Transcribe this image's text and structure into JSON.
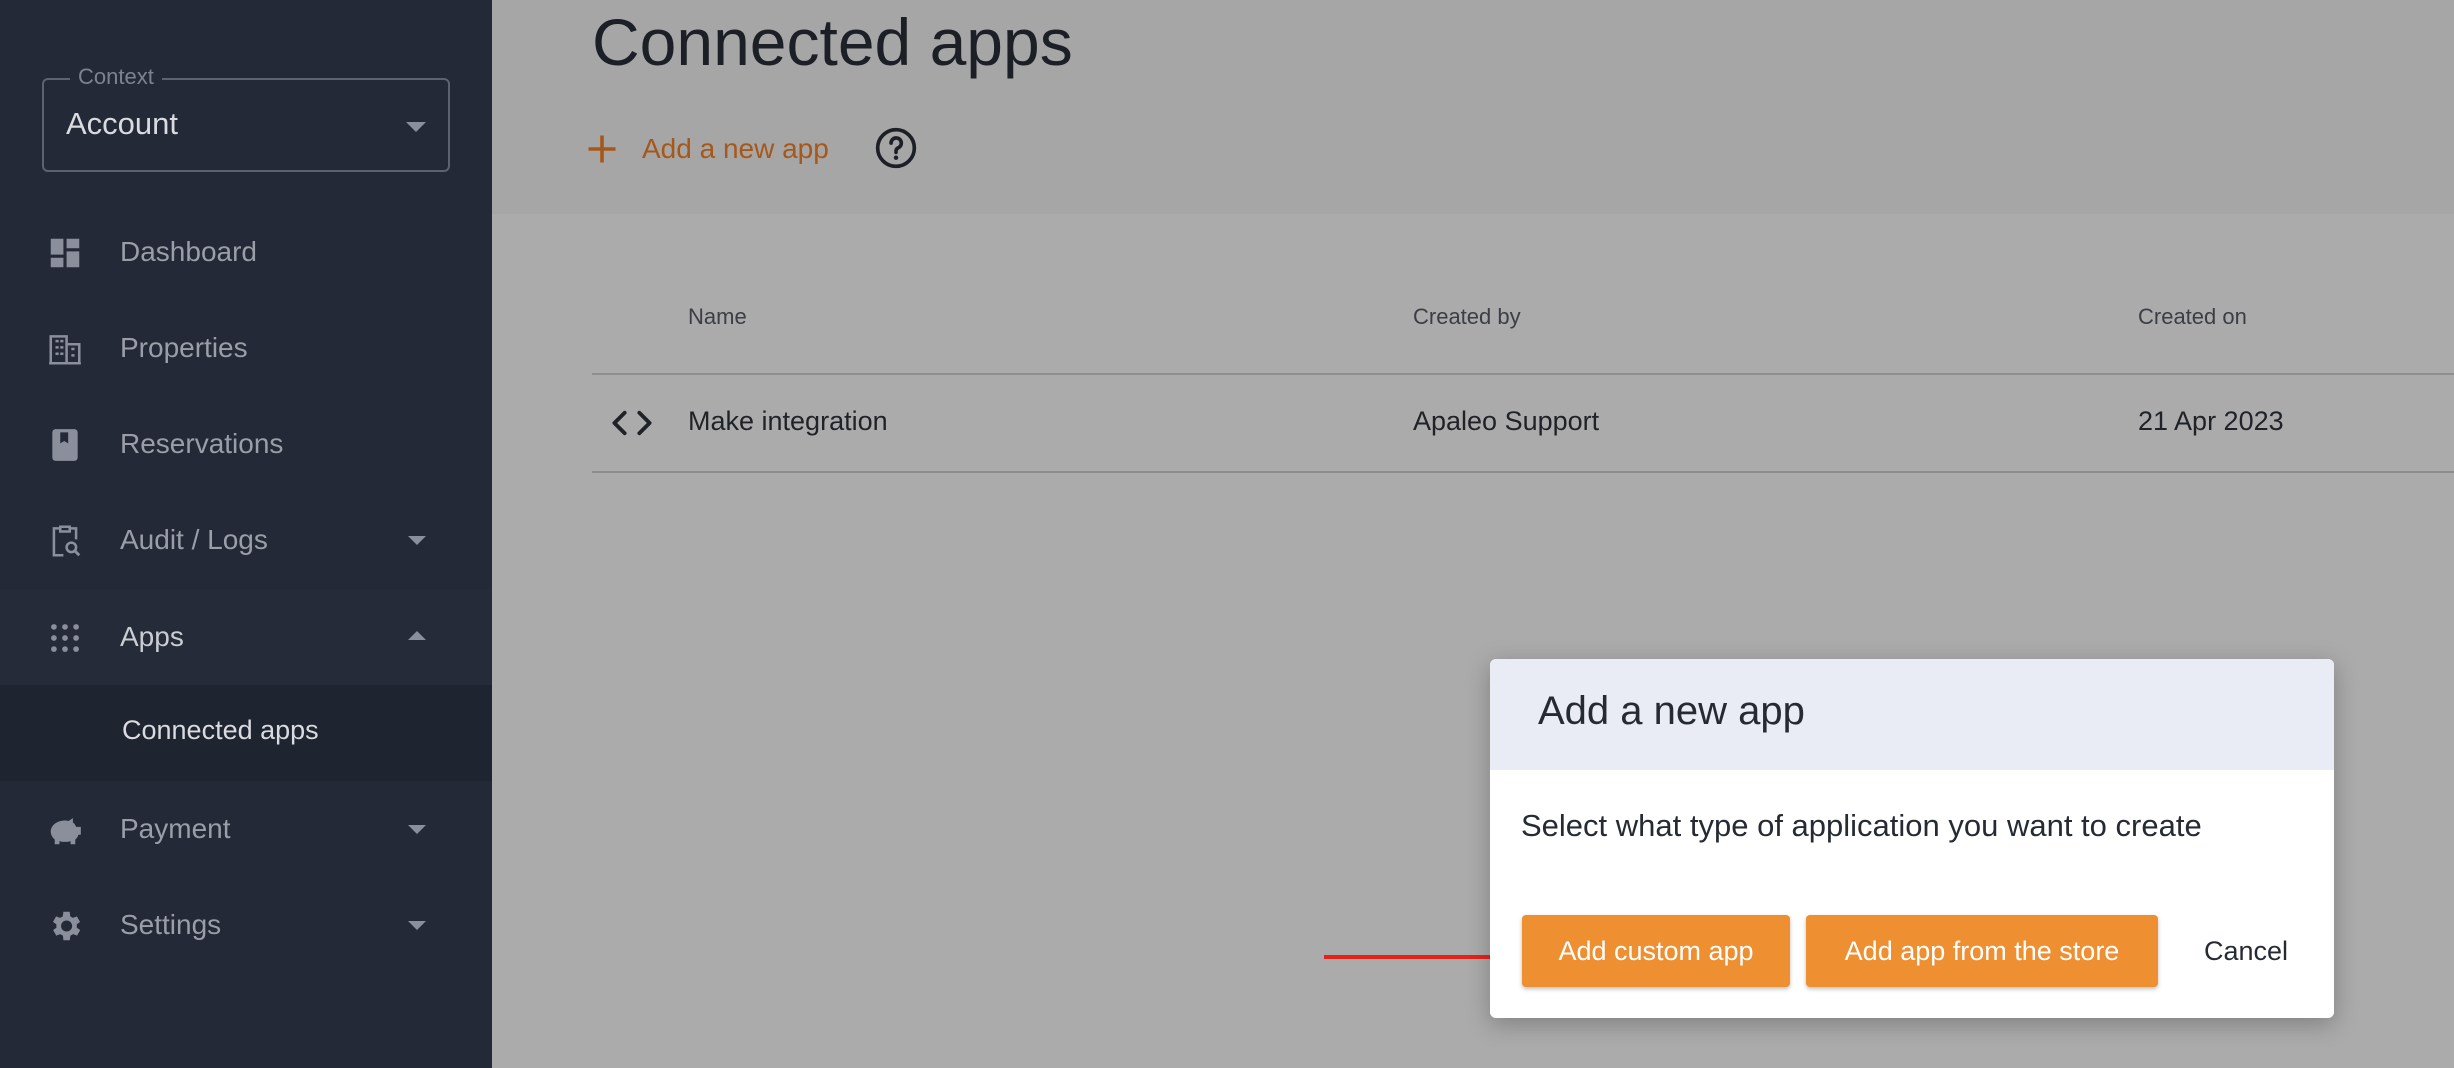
{
  "sidebar": {
    "context": {
      "label": "Context",
      "value": "Account"
    },
    "items": [
      {
        "label": "Dashboard",
        "icon": "dashboard-icon"
      },
      {
        "label": "Properties",
        "icon": "building-icon"
      },
      {
        "label": "Reservations",
        "icon": "book-icon"
      },
      {
        "label": "Audit / Logs",
        "icon": "clipboard-search-icon"
      },
      {
        "label": "Apps",
        "icon": "apps-grid-icon"
      },
      {
        "label": "Payment",
        "icon": "piggy-bank-icon"
      },
      {
        "label": "Settings",
        "icon": "gear-icon"
      }
    ],
    "subitem": {
      "label": "Connected apps"
    }
  },
  "header": {
    "title": "Connected apps",
    "add_label": "Add a new app"
  },
  "table": {
    "columns": [
      "Name",
      "Created by",
      "Created on"
    ],
    "rows": [
      {
        "name": "Make integration",
        "created_by": "Apaleo Support",
        "created_on": "21 Apr 2023"
      }
    ]
  },
  "dialog": {
    "title": "Add a new app",
    "body": "Select what type of application you want to create",
    "buttons": {
      "custom": "Add custom app",
      "store": "Add app from the store",
      "cancel": "Cancel"
    }
  },
  "colors": {
    "sidebar_bg": "#232936",
    "accent": "#ee8f31",
    "link": "#a5581a",
    "arrow": "#e5231b"
  }
}
